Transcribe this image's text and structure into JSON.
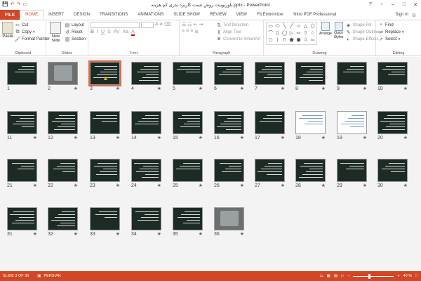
{
  "window": {
    "title": "پاورپوینت روش تست کاربرد بذری کم هزینه.pptx - PowerPoint",
    "quick_access": [
      {
        "name": "save-icon",
        "glyph": "💾"
      },
      {
        "name": "undo-icon",
        "glyph": "↶"
      },
      {
        "name": "redo-icon",
        "glyph": "↷"
      },
      {
        "name": "start-slideshow-icon",
        "glyph": "▭"
      }
    ],
    "controls": [
      {
        "name": "help-icon",
        "glyph": "?"
      },
      {
        "name": "ribbon-display-icon",
        "glyph": "▫"
      },
      {
        "name": "minimize-icon",
        "glyph": "–"
      },
      {
        "name": "maximize-icon",
        "glyph": "□"
      },
      {
        "name": "close-icon",
        "glyph": "✕"
      }
    ]
  },
  "tabs": {
    "file": "FILE",
    "items": [
      "HOME",
      "INSERT",
      "DESIGN",
      "TRANSITIONS",
      "ANIMATIONS",
      "SLIDE SHOW",
      "REVIEW",
      "VIEW",
      "FILEminimizer",
      "Nitro PDF Professional"
    ],
    "active": "HOME",
    "sign_in": "Sign in"
  },
  "ribbon": {
    "clipboard": {
      "label": "Clipboard",
      "paste": "Paste",
      "cut": "Cut",
      "copy": "Copy",
      "format_painter": "Format Painter"
    },
    "slides": {
      "label": "Slides",
      "new_slide": "New Slide",
      "layout": "Layout",
      "reset": "Reset",
      "section": "Section"
    },
    "font": {
      "label": "Font",
      "bold": "B",
      "italic": "I",
      "underline": "U",
      "strike": "S",
      "clear": "A"
    },
    "paragraph": {
      "label": "Paragraph",
      "text_direction": "Text Direction",
      "align_text": "Align Text",
      "convert_smartart": "Convert to SmartArt"
    },
    "drawing": {
      "label": "Drawing",
      "arrange": "Arrange",
      "quick_styles": "Quick Styles",
      "shape_fill": "Shape Fill",
      "shape_outline": "Shape Outline",
      "shape_effects": "Shape Effects",
      "shape_glyphs": [
        "▭",
        "⬭",
        "╲",
        "╱",
        "▱",
        "△",
        "⬠",
        "⌒",
        "▯",
        "◯",
        "▷",
        "⇨",
        "⇧",
        "☆",
        "⬡",
        "⌇",
        "⊓",
        "⬟",
        "⬢",
        "⇩",
        "⇦"
      ]
    },
    "editing": {
      "label": "Editing",
      "find": "Find",
      "replace": "Replace",
      "select": "Select"
    }
  },
  "slides": [
    {
      "num": "1",
      "style": "dark",
      "star": false
    },
    {
      "num": "2",
      "style": "photo",
      "star": true
    },
    {
      "num": "3",
      "style": "dark",
      "star": true,
      "selected": true
    },
    {
      "num": "4",
      "style": "dark",
      "star": true
    },
    {
      "num": "5",
      "style": "dark",
      "star": true
    },
    {
      "num": "6",
      "style": "dark",
      "star": true
    },
    {
      "num": "7",
      "style": "dark",
      "star": true
    },
    {
      "num": "8",
      "style": "dark",
      "star": true
    },
    {
      "num": "9",
      "style": "dark",
      "star": true
    },
    {
      "num": "10",
      "style": "dark",
      "star": true
    },
    {
      "num": "11",
      "style": "dark",
      "star": true
    },
    {
      "num": "12",
      "style": "dark",
      "star": true
    },
    {
      "num": "13",
      "style": "dark",
      "star": true
    },
    {
      "num": "14",
      "style": "dark",
      "star": true
    },
    {
      "num": "15",
      "style": "dark",
      "star": true
    },
    {
      "num": "16",
      "style": "dark",
      "star": true
    },
    {
      "num": "17",
      "style": "dark",
      "star": true
    },
    {
      "num": "18",
      "style": "light",
      "star": true
    },
    {
      "num": "19",
      "style": "light",
      "star": true
    },
    {
      "num": "20",
      "style": "dark",
      "star": true
    },
    {
      "num": "21",
      "style": "dark",
      "star": true
    },
    {
      "num": "22",
      "style": "dark",
      "star": true
    },
    {
      "num": "23",
      "style": "dark",
      "star": true
    },
    {
      "num": "24",
      "style": "dark",
      "star": true
    },
    {
      "num": "25",
      "style": "dark",
      "star": true
    },
    {
      "num": "26",
      "style": "dark",
      "star": true
    },
    {
      "num": "27",
      "style": "dark",
      "star": true
    },
    {
      "num": "28",
      "style": "dark",
      "star": true
    },
    {
      "num": "29",
      "style": "dark",
      "star": true
    },
    {
      "num": "30",
      "style": "dark",
      "star": true
    },
    {
      "num": "31",
      "style": "dark",
      "star": true
    },
    {
      "num": "32",
      "style": "dark",
      "star": true
    },
    {
      "num": "33",
      "style": "dark",
      "star": true
    },
    {
      "num": "34",
      "style": "dark",
      "star": true
    },
    {
      "num": "35",
      "style": "dark",
      "star": true
    },
    {
      "num": "36",
      "style": "photo",
      "star": true
    }
  ],
  "status": {
    "slide_count": "SLIDE 3 OF 36",
    "language": "PERSIAN",
    "zoom": "40 %",
    "zoom_level": 0.4
  },
  "colors": {
    "accent": "#d24726",
    "slide_bg": "#1d2b25",
    "selected": "#e16a4a"
  }
}
